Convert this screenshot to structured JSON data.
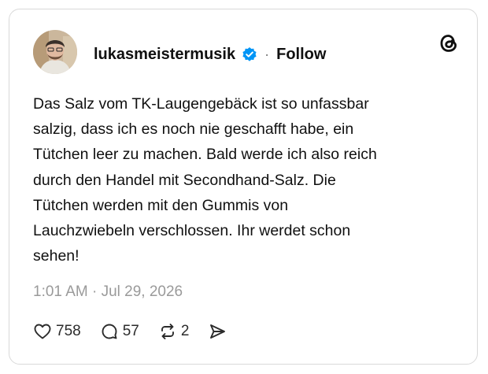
{
  "post": {
    "username": "lukasmeistermusik",
    "verified_icon": "verified-badge-icon",
    "separator": "·",
    "follow_label": "Follow",
    "brand_icon": "threads-logo-icon",
    "text_lines": [
      "Das Salz vom TK-Laugengebäck ist so unfassbar",
      "salzig, dass ich es noch nie geschafft habe, ein",
      "Tütchen leer zu machen. Bald werde ich also reich",
      "durch den Handel mit Secondhand-Salz. Die",
      "Tütchen werden mit den Gummis von",
      "Lauchzwiebeln verschlossen. Ihr werdet schon",
      "sehen!"
    ],
    "timestamp": "1:01 AM · Jul 29, 2026",
    "likes": "758",
    "replies": "57",
    "reposts": "2",
    "share_icon": "send-icon"
  },
  "colors": {
    "verified": "#0095f6",
    "muted_text": "#9a9a9a",
    "border": "#d9d9d9"
  }
}
